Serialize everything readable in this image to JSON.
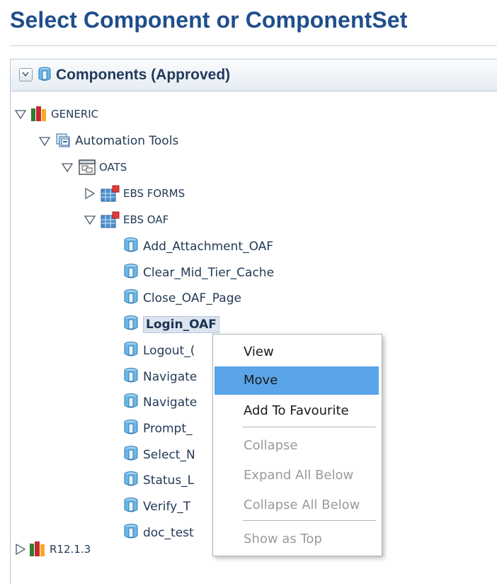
{
  "page": {
    "title": "Select Component or ComponentSet"
  },
  "panel": {
    "title": "Components (Approved)"
  },
  "tree": {
    "root1": "GENERIC",
    "level1": "Automation Tools",
    "level2": "OATS",
    "forms": "EBS FORMS",
    "oaf": "EBS OAF",
    "components": [
      "Add_Attachment_OAF",
      "Clear_Mid_Tier_Cache",
      "Close_OAF_Page",
      "Login_OAF",
      "Logout_(",
      "Navigate",
      "Navigate",
      "Prompt_",
      "Select_N",
      "Status_L",
      "Verify_T",
      "doc_test"
    ],
    "root2": "R12.1.3"
  },
  "context_menu": {
    "items": [
      "View",
      "Move",
      "Add To Favourite",
      "Collapse",
      "Expand All Below",
      "Collapse All Below",
      "Show as Top"
    ],
    "hover_index": 1,
    "disabled": [
      "Collapse",
      "Expand All Below",
      "Collapse All Below",
      "Show as Top"
    ]
  },
  "colors": {
    "title": "#1f4e8c",
    "menu_hover": "#5aa4e8",
    "selected_bg": "#dbe4ef"
  }
}
